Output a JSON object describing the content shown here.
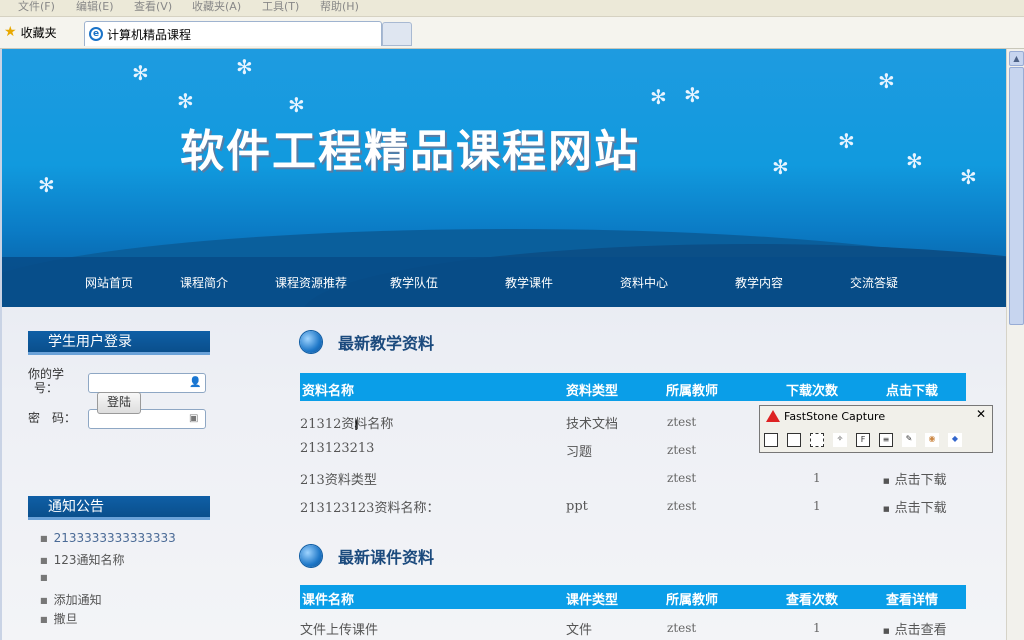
{
  "browser": {
    "menus": [
      "文件(F)",
      "编辑(E)",
      "查看(V)",
      "收藏夹(A)",
      "工具(T)",
      "帮助(H)"
    ],
    "favorites_label": "收藏夹",
    "tab_title": "计算机精品课程"
  },
  "site": {
    "banner_title": "软件工程精品课程网站",
    "nav": [
      "网站首页",
      "课程简介",
      "课程资源推荐",
      "教学队伍",
      "教学课件",
      "资料中心",
      "教学内容",
      "交流答疑"
    ]
  },
  "login": {
    "heading": "学生用户登录",
    "student_id_label_1": "你的学",
    "student_id_label_2": "号：",
    "password_label": "密　码：",
    "submit": "登陆"
  },
  "notices": {
    "heading": "通知公告",
    "items": [
      "2133333333333333",
      "123通知名称",
      "",
      "添加通知",
      "撒旦"
    ]
  },
  "materials": {
    "heading": "最新教学资料",
    "columns": [
      "资料名称",
      "资料类型",
      "所属教师",
      "下载次数",
      "点击下载"
    ],
    "rows": [
      {
        "name": "21312资料名称",
        "type": "技术文档",
        "teacher": "ztest",
        "count": "",
        "action": ""
      },
      {
        "name": "213123213",
        "type": "习题",
        "teacher": "ztest",
        "count": "",
        "action": ""
      },
      {
        "name": "213资料类型",
        "type": "",
        "teacher": "ztest",
        "count": "1",
        "action": "点击下载"
      },
      {
        "name": "213123123资料名称：",
        "type": "ppt",
        "teacher": "ztest",
        "count": "1",
        "action": "点击下载"
      }
    ]
  },
  "courseware": {
    "heading": "最新课件资料",
    "columns": [
      "课件名称",
      "课件类型",
      "所属教师",
      "查看次数",
      "查看详情"
    ],
    "rows": [
      {
        "name": "文件上传课件",
        "type": "文件",
        "teacher": "ztest",
        "count": "1",
        "action": "点击查看"
      }
    ]
  },
  "faststone": {
    "title": "FastStone Capture",
    "close": "✕"
  }
}
